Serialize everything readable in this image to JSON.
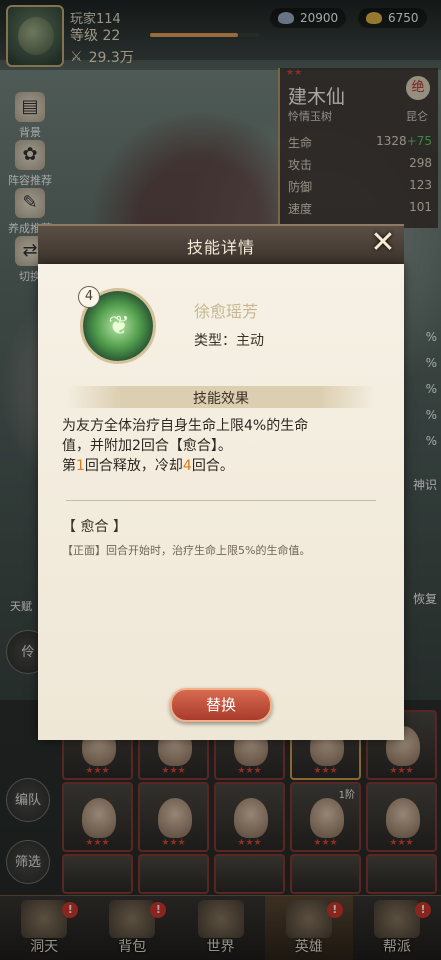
{
  "player": {
    "name": "玩家114",
    "level": "等级 22",
    "level_progress": 0.8,
    "power": "29.3万",
    "currency_1": "20900",
    "currency_2": "6750"
  },
  "side_buttons": [
    {
      "label": "背景",
      "icon": "scroll-icon"
    },
    {
      "label": "阵容推荐",
      "icon": "lotus-icon"
    },
    {
      "label": "养成推荐",
      "icon": "book-icon"
    },
    {
      "label": "切换",
      "icon": "switch-icon"
    }
  ],
  "hero": {
    "name": "建木仙",
    "badge": "绝",
    "title": "怜情玉树",
    "faction": "昆仑",
    "stats": [
      {
        "label": "生命",
        "value": "1328",
        "bonus": "+75"
      },
      {
        "label": "攻击",
        "value": "298",
        "bonus": ""
      },
      {
        "label": "防御",
        "value": "123",
        "bonus": ""
      },
      {
        "label": "速度",
        "value": "101",
        "bonus": ""
      }
    ]
  },
  "right_strip": [
    "%",
    "%",
    "%",
    "%",
    "%",
    "神识",
    "恢复"
  ],
  "left_buttons": {
    "talent": "天赋",
    "refine": "伶",
    "formation": "编队",
    "filter": "筛选"
  },
  "card_level": "1阶",
  "dialog": {
    "title": "技能详情",
    "close_icon": "close-icon",
    "skill_level": "4",
    "skill_name": "徐愈瑶芳",
    "skill_type": "类型：主动",
    "effect_header": "技能效果",
    "effect_line1": "为友方全体治疗自身生命上限4%的生命",
    "effect_line2": "值，并附加2回合【愈合】。",
    "effect_line3_pre": "第",
    "effect_line3_num1": "1",
    "effect_line3_mid": "回合释放，冷却",
    "effect_line3_num2": "4",
    "effect_line3_post": "回合。",
    "buff_title": "【 愈合 】",
    "buff_text": "【正面】回合开始时，治疗生命上限5%的生命值。",
    "replace_label": "替换"
  },
  "bottom_nav": [
    {
      "label": "洞天",
      "badge": "!"
    },
    {
      "label": "背包",
      "badge": "!"
    },
    {
      "label": "世界",
      "badge": ""
    },
    {
      "label": "英雄",
      "badge": "!"
    },
    {
      "label": "帮派",
      "badge": "!"
    }
  ]
}
